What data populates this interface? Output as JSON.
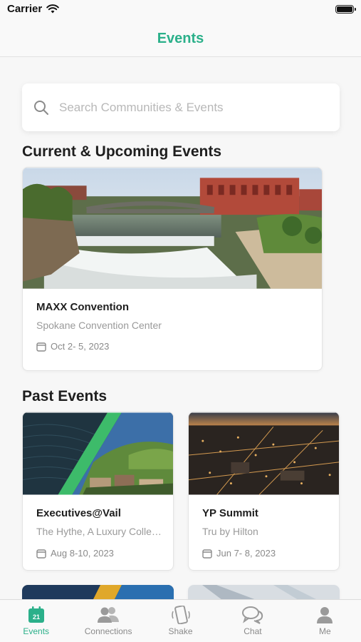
{
  "status": {
    "carrier": "Carrier"
  },
  "nav": {
    "title": "Events"
  },
  "search": {
    "placeholder": "Search Communities & Events"
  },
  "sections": {
    "current": "Current & Upcoming Events",
    "past": "Past Events"
  },
  "current_events": [
    {
      "name": "MAXX Convention",
      "venue": "Spokane Convention Center",
      "date": "Oct  2- 5, 2023"
    }
  ],
  "past_events": [
    {
      "name": "Executives@Vail",
      "venue": "The Hythe, A Luxury Collect...",
      "date": "Aug  8-10, 2023"
    },
    {
      "name": "YP Summit",
      "venue": "Tru by Hilton",
      "date": "Jun  7- 8, 2023"
    }
  ],
  "tabs": [
    {
      "label": "Events",
      "icon": "calendar-icon",
      "active": true,
      "badge": "21"
    },
    {
      "label": "Connections",
      "icon": "people-icon",
      "active": false
    },
    {
      "label": "Shake",
      "icon": "phone-shake-icon",
      "active": false
    },
    {
      "label": "Chat",
      "icon": "chat-bubbles-icon",
      "active": false
    },
    {
      "label": "Me",
      "icon": "person-icon",
      "active": false
    }
  ],
  "colors": {
    "accent": "#2bb08a",
    "muted": "#9a9a9a",
    "background": "#f7f7f7"
  }
}
